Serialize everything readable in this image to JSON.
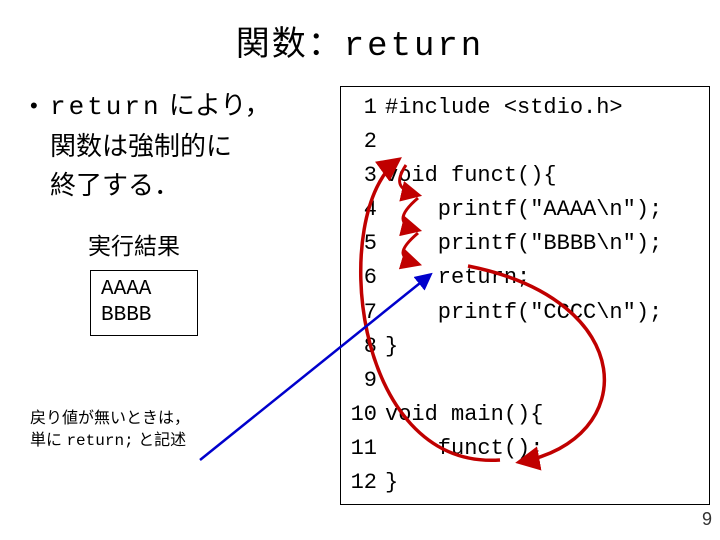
{
  "title_jp": "関数：",
  "title_en": "return",
  "bullet": {
    "prefix": "return",
    "line1_suffix": " により，",
    "line2": "関数は強制的に",
    "line3": "終了する．"
  },
  "exec_label": "実行結果",
  "exec_output": [
    "AAAA",
    "BBBB"
  ],
  "note_line1": "戻り値が無いときは，",
  "note_line2_pre": "単に ",
  "note_line2_code": "return;",
  "note_line2_post": " と記述",
  "code": [
    {
      "n": "1",
      "t": "#include <stdio.h>"
    },
    {
      "n": "2",
      "t": ""
    },
    {
      "n": "3",
      "t": "void funct(){"
    },
    {
      "n": "4",
      "t": "    printf(\"AAAA\\n\");"
    },
    {
      "n": "5",
      "t": "    printf(\"BBBB\\n\");"
    },
    {
      "n": "6",
      "t": "    return;"
    },
    {
      "n": "7",
      "t": "    printf(\"CCCC\\n\");"
    },
    {
      "n": "8",
      "t": "}"
    },
    {
      "n": "9",
      "t": ""
    },
    {
      "n": "10",
      "t": "void main(){"
    },
    {
      "n": "11",
      "t": "    funct();"
    },
    {
      "n": "12",
      "t": "}"
    }
  ],
  "page_number": "9",
  "colors": {
    "arrow_red": "#C00000",
    "arrow_blue": "#0000CC"
  }
}
